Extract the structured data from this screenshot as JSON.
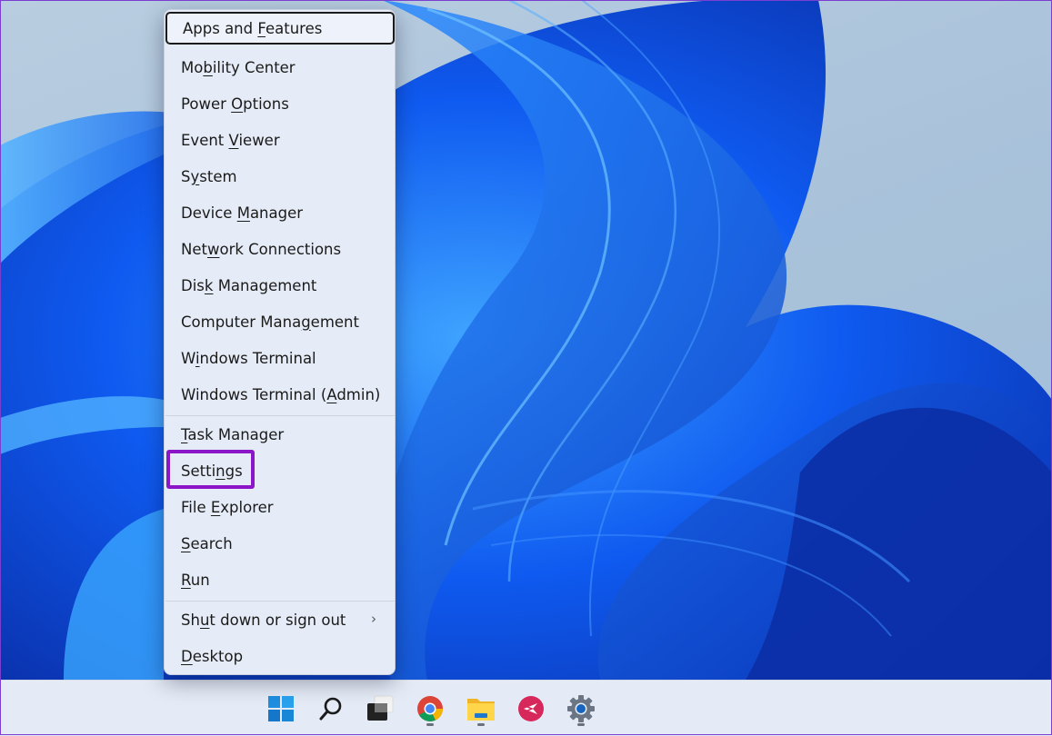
{
  "context_menu": {
    "groups": [
      [
        {
          "id": "apps-and-features",
          "pre": "Apps and ",
          "key": "F",
          "post": "eatures",
          "focused": true
        },
        {
          "id": "mobility-center",
          "pre": "Mo",
          "key": "b",
          "post": "ility Center"
        },
        {
          "id": "power-options",
          "pre": "Power ",
          "key": "O",
          "post": "ptions"
        },
        {
          "id": "event-viewer",
          "pre": "Event ",
          "key": "V",
          "post": "iewer"
        },
        {
          "id": "system",
          "pre": "S",
          "key": "y",
          "post": "stem"
        },
        {
          "id": "device-manager",
          "pre": "Device ",
          "key": "M",
          "post": "anager"
        },
        {
          "id": "network-connections",
          "pre": "Net",
          "key": "w",
          "post": "ork Connections"
        },
        {
          "id": "disk-management",
          "pre": "Dis",
          "key": "k",
          "post": " Management"
        },
        {
          "id": "computer-management",
          "pre": "Computer Mana",
          "key": "g",
          "post": "ement"
        },
        {
          "id": "windows-terminal",
          "pre": "W",
          "key": "i",
          "post": "ndows Terminal"
        },
        {
          "id": "windows-terminal-admin",
          "pre": "Windows Terminal (",
          "key": "A",
          "post": "dmin)"
        }
      ],
      [
        {
          "id": "task-manager",
          "pre": "",
          "key": "T",
          "post": "ask Manager"
        },
        {
          "id": "settings",
          "pre": "Setti",
          "key": "n",
          "post": "gs",
          "highlighted": true
        },
        {
          "id": "file-explorer",
          "pre": "File ",
          "key": "E",
          "post": "xplorer"
        },
        {
          "id": "search",
          "pre": "",
          "key": "S",
          "post": "earch"
        },
        {
          "id": "run",
          "pre": "",
          "key": "R",
          "post": "un"
        }
      ],
      [
        {
          "id": "shut-down-or-sign-out",
          "pre": "Sh",
          "key": "u",
          "post": "t down or sign out",
          "submenu": true,
          "submenu_icon": "chevron-right-icon"
        },
        {
          "id": "desktop",
          "pre": "",
          "key": "D",
          "post": "esktop"
        }
      ]
    ],
    "annotation_color": "#8a16c8"
  },
  "taskbar": {
    "items": [
      {
        "id": "start",
        "icon": "windows-start-icon",
        "running": false
      },
      {
        "id": "search",
        "icon": "search-icon",
        "running": false
      },
      {
        "id": "task-view",
        "icon": "task-view-icon",
        "running": false
      },
      {
        "id": "chrome",
        "icon": "chrome-icon",
        "running": true
      },
      {
        "id": "file-explorer",
        "icon": "folder-icon",
        "running": true
      },
      {
        "id": "app",
        "icon": "red-bird-app-icon",
        "running": false
      },
      {
        "id": "settings",
        "icon": "gear-icon",
        "running": true
      }
    ]
  }
}
